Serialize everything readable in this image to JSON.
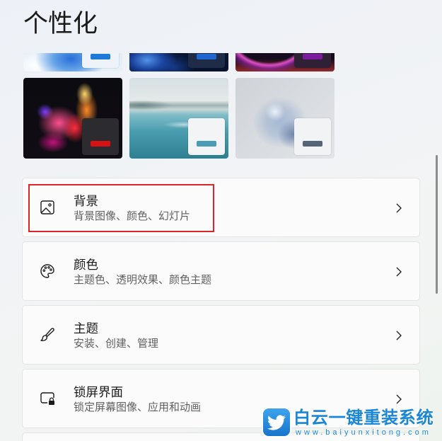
{
  "page": {
    "title": "个性化"
  },
  "themes": [
    {
      "accent_color": "#1e7ad6",
      "overlay_color": "#eef3fa"
    },
    {
      "accent_color": "#1f66d1",
      "overlay_color": "#1f2c47"
    },
    {
      "accent_color": "#7b1b9e",
      "overlay_color": "#2f2035"
    },
    {
      "accent_color": "#d61212",
      "overlay_color": "#2c2c30"
    },
    {
      "accent_color": "#4b9bb4",
      "overlay_color": "#f2f4f5"
    },
    {
      "accent_color": "#556577",
      "overlay_color": "#f2f3f5"
    }
  ],
  "settings": {
    "items": [
      {
        "title": "背景",
        "subtitle": "背景图像、颜色、幻灯片",
        "icon": "image-icon"
      },
      {
        "title": "颜色",
        "subtitle": "主题色、透明效果、颜色主题",
        "icon": "palette-icon"
      },
      {
        "title": "主题",
        "subtitle": "安装、创建、管理",
        "icon": "brush-icon"
      },
      {
        "title": "锁屏界面",
        "subtitle": "锁定屏幕图像、应用和动画",
        "icon": "lock-screen-icon"
      }
    ],
    "chevron_icon": "chevron-right-icon"
  },
  "annotation": {
    "highlight_color": "#d9262b"
  },
  "watermark": {
    "brand": "白云一键重装系统",
    "url": "www.baiyunxitong.com",
    "logo_icon": "bird-logo-icon",
    "color": "#1a86d6"
  }
}
